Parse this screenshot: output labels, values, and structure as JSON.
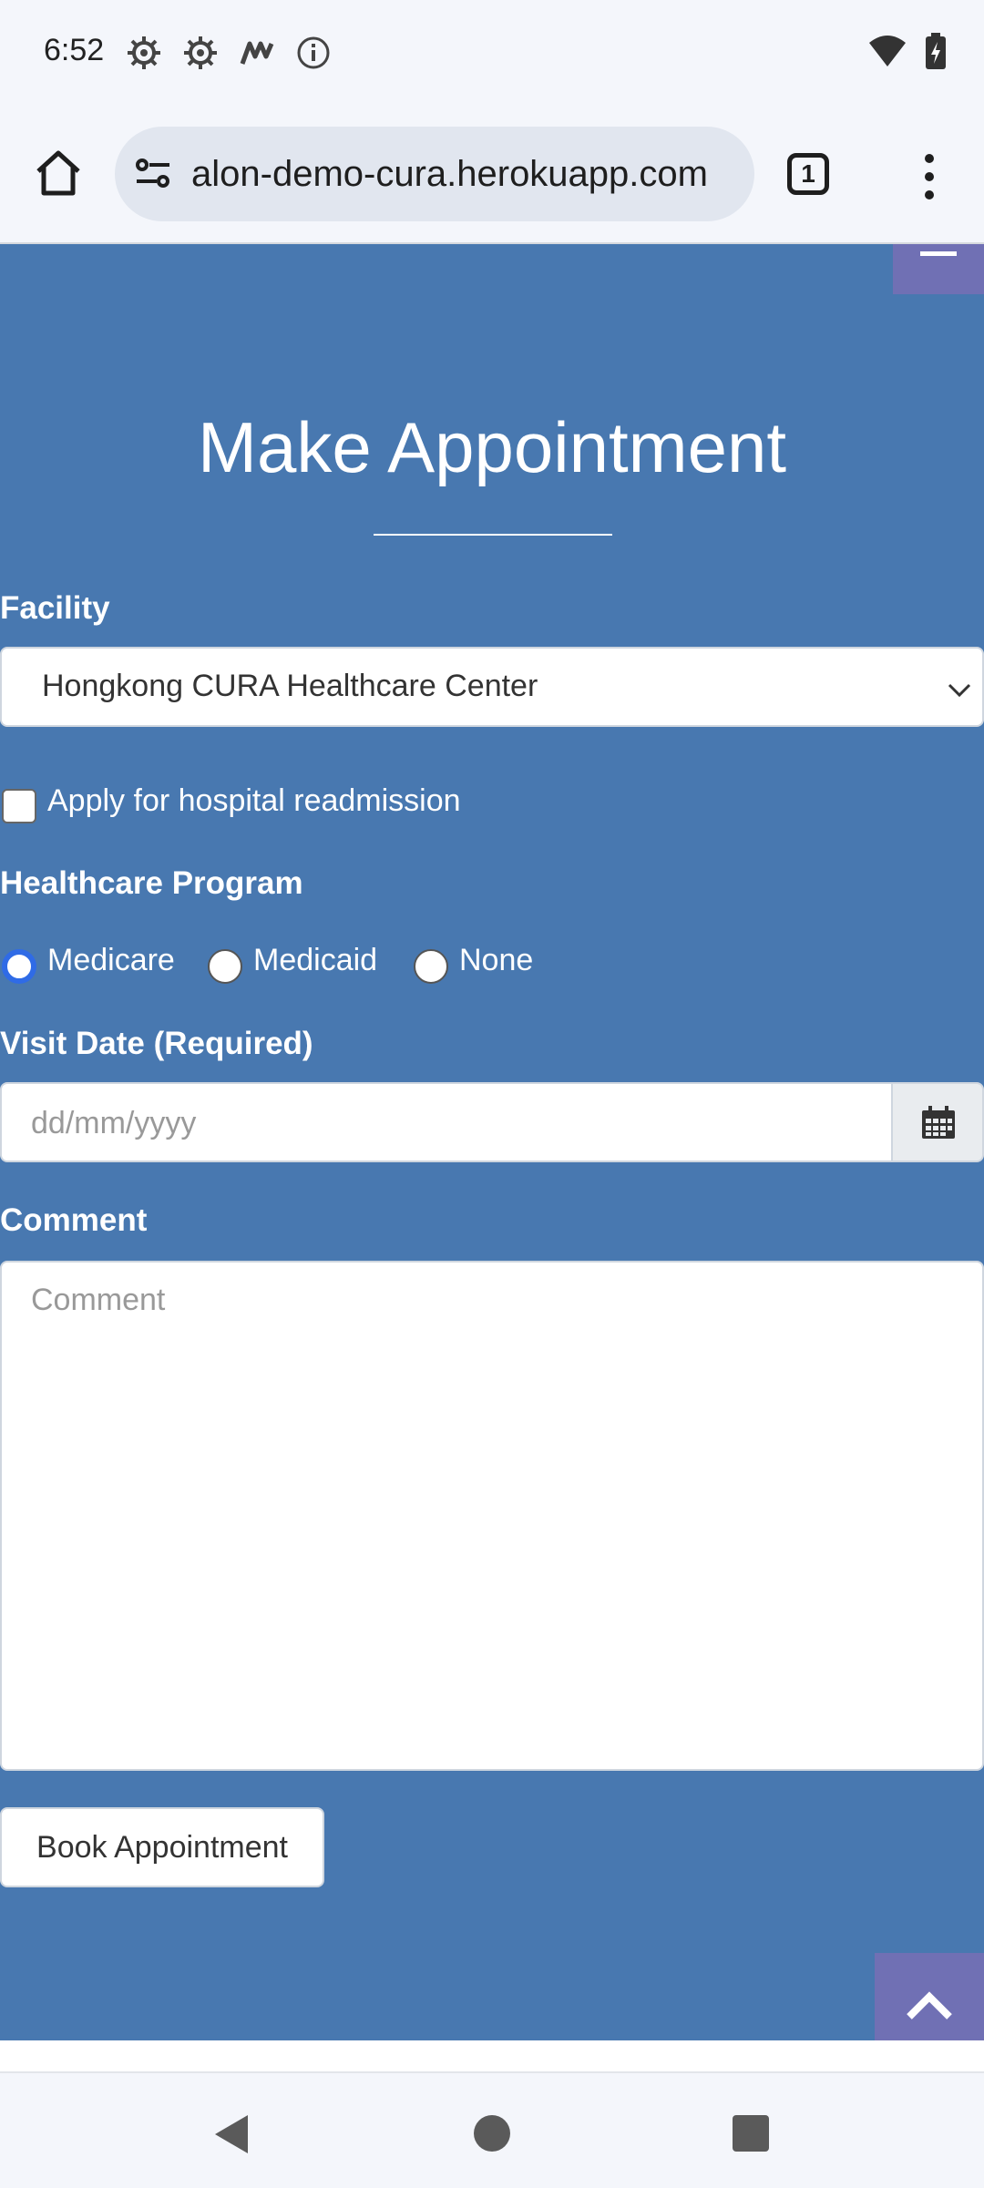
{
  "status_bar": {
    "time": "6:52",
    "left_icons": [
      "gear-icon",
      "gear-icon",
      "notification-icon",
      "info-icon"
    ],
    "right_icons": [
      "wifi-icon",
      "battery-charging-icon"
    ]
  },
  "browser": {
    "url": "alon-demo-cura.herokuapp.com",
    "tab_count": "1"
  },
  "page": {
    "title": "Make Appointment",
    "facility": {
      "label": "Facility",
      "selected": "Hongkong CURA Healthcare Center"
    },
    "readmission": {
      "label": "Apply for hospital readmission",
      "checked": false
    },
    "program": {
      "label": "Healthcare Program",
      "options": [
        "Medicare",
        "Medicaid",
        "None"
      ],
      "selected": "Medicare"
    },
    "visit_date": {
      "label": "Visit Date (Required)",
      "placeholder": "dd/mm/yyyy"
    },
    "comment": {
      "label": "Comment",
      "placeholder": "Comment"
    },
    "submit_label": "Book Appointment"
  },
  "colors": {
    "page_background": "#4878b0",
    "accent_purple": "#7070b4",
    "radio_selected": "#2f6be6"
  }
}
